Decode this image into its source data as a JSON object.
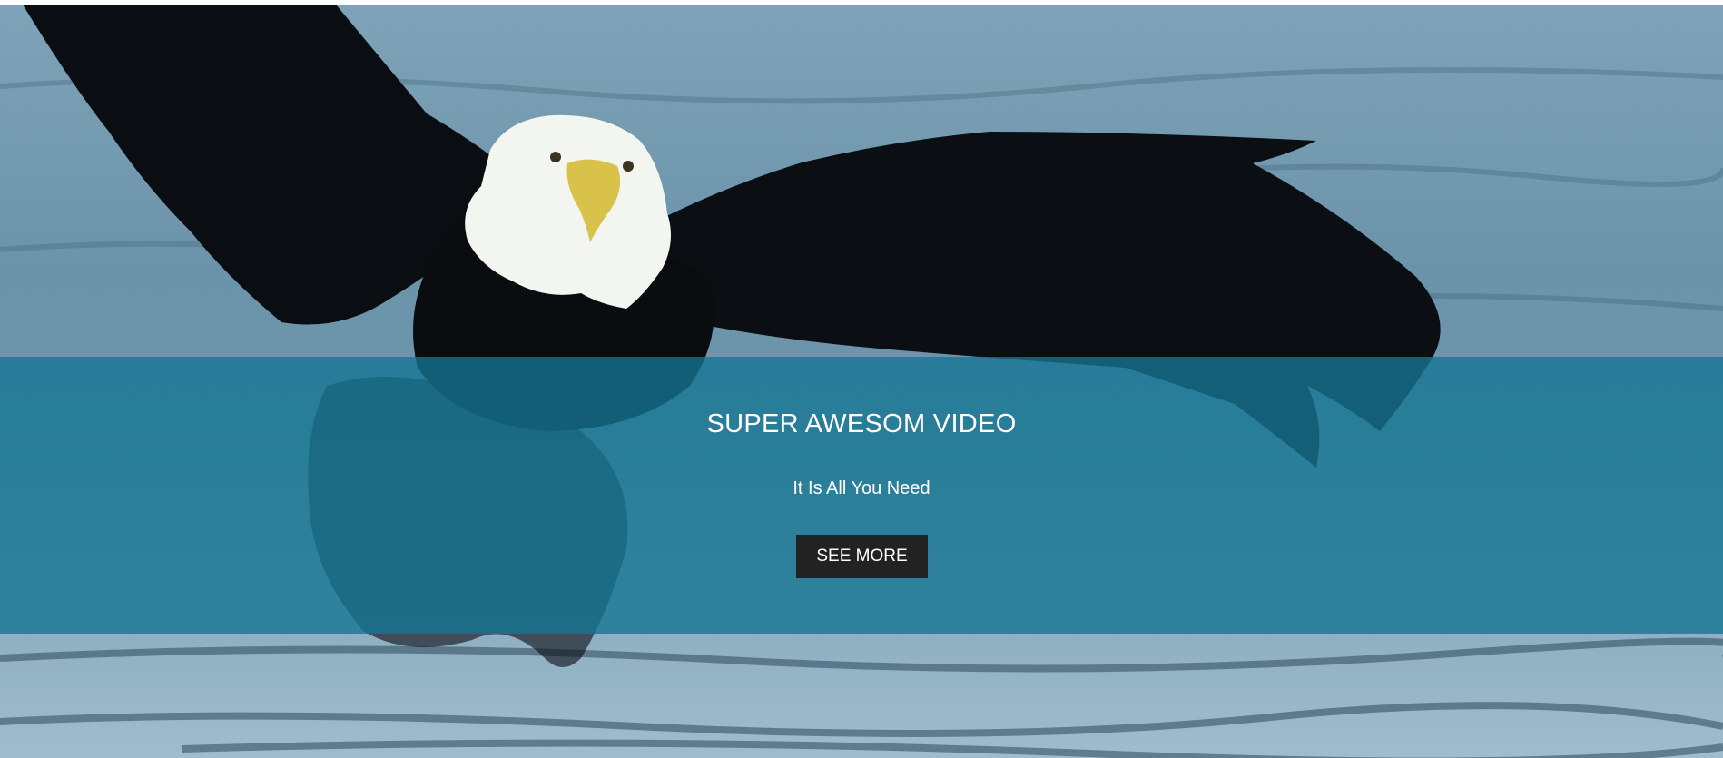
{
  "hero": {
    "title": "SUPER AWESOM VIDEO",
    "subtitle": "It Is All You Need",
    "cta_label": "SEE MORE"
  },
  "colors": {
    "overlay": "#1f7fa0",
    "button": "#222222",
    "text": "#ffffff"
  },
  "media": {
    "background": "bald-eagle-over-water-video"
  }
}
